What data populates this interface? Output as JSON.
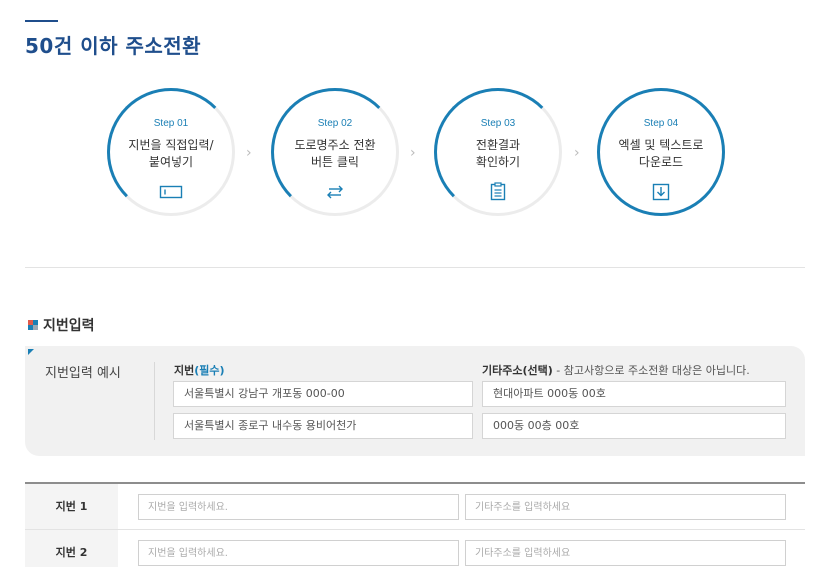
{
  "page": {
    "title": "50건 이하 주소전환"
  },
  "steps": [
    {
      "label": "Step 01",
      "text": "지번을 직접입력/\n붙여넣기",
      "icon": "input-box-icon"
    },
    {
      "label": "Step 02",
      "text": "도로명주소 전환\n버튼 클릭",
      "icon": "swap-arrows-icon"
    },
    {
      "label": "Step 03",
      "text": "전환결과\n확인하기",
      "icon": "clipboard-icon"
    },
    {
      "label": "Step 04",
      "text": "엑셀 및 텍스트로\n다운로드",
      "icon": "download-icon"
    }
  ],
  "section": {
    "title": "지번입력"
  },
  "example": {
    "title": "지번입력 예시",
    "col1_label": "지번",
    "col1_required": "(필수)",
    "col2_label": "기타주소(선택)",
    "col2_note": " - 참고사항으로 주소전환 대상은 아닙니다.",
    "rows": [
      {
        "jibun": "서울특별시 강남구 개포동 000-00",
        "etc": "현대아파트 000동 00호"
      },
      {
        "jibun": "서울특별시 종로구 내수동 용비어천가",
        "etc": "000동 00층 00호"
      }
    ]
  },
  "form": {
    "rows": [
      {
        "label": "지번 1",
        "jibun_placeholder": "지번을 입력하세요.",
        "etc_placeholder": "기타주소를 입력하세요"
      },
      {
        "label": "지번 2",
        "jibun_placeholder": "지번을 입력하세요.",
        "etc_placeholder": "기타주소를 입력하세요"
      }
    ]
  },
  "colors": {
    "primary": "#1a7fb5",
    "title": "#1f4e8c"
  }
}
